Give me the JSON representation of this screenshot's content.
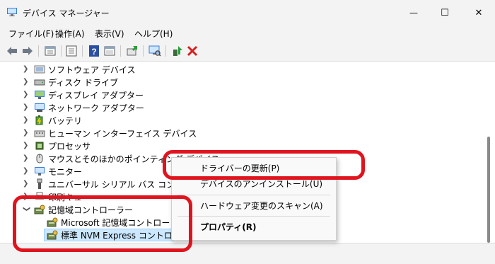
{
  "window": {
    "title": "デバイス マネージャー",
    "controls": {
      "minimize": "—",
      "maximize": "☐",
      "close": "✕"
    }
  },
  "menu": {
    "items": [
      "ファイル(F)",
      "操作(A)",
      "表示(V)",
      "ヘルプ(H)"
    ]
  },
  "toolbar": {
    "icons": [
      "back-arrow-icon",
      "forward-arrow-icon",
      "properties-sheet-icon",
      "console-tree-icon",
      "help-icon",
      "action-pane-icon",
      "update-driver-icon",
      "scan-hardware-icon",
      "enable-device-icon",
      "uninstall-x-icon"
    ]
  },
  "tree": {
    "items": [
      {
        "label": "ソフトウェア デバイス",
        "icon": "software-device-icon",
        "expanded": false
      },
      {
        "label": "ディスク ドライブ",
        "icon": "disk-drive-icon",
        "expanded": false
      },
      {
        "label": "ディスプレイ アダプター",
        "icon": "display-adapter-icon",
        "expanded": false
      },
      {
        "label": "ネットワーク アダプター",
        "icon": "network-adapter-icon",
        "expanded": false
      },
      {
        "label": "バッテリ",
        "icon": "battery-icon",
        "expanded": false
      },
      {
        "label": "ヒューマン インターフェイス デバイス",
        "icon": "hid-icon",
        "expanded": false
      },
      {
        "label": "プロセッサ",
        "icon": "processor-icon",
        "expanded": false
      },
      {
        "label": "マウスとそのほかのポインティング デバイス",
        "icon": "mouse-icon",
        "expanded": false
      },
      {
        "label": "モニター",
        "icon": "monitor-icon",
        "expanded": false
      },
      {
        "label": "ユニバーサル シリアル バス コントローラー",
        "icon": "usb-icon",
        "expanded": false
      },
      {
        "label": "印刷キュー",
        "icon": "print-queue-icon",
        "expanded": false
      },
      {
        "label": "記憶域コントローラー",
        "icon": "storage-controller-icon",
        "expanded": true
      },
      {
        "label": "Microsoft 記憶域コントローラー",
        "icon": "storage-controller-icon",
        "child": true
      },
      {
        "label": "標準 NVM Express コントローラー",
        "icon": "storage-controller-icon",
        "child": true,
        "selected": true
      }
    ]
  },
  "context_menu": {
    "items": [
      "ドライバーの更新(P)",
      "デバイスのアンインストール(U)",
      "ハードウェア変更のスキャン(A)",
      "プロパティ(R)"
    ]
  },
  "colors": {
    "highlight": "#e0141e",
    "selection": "#cce8ff"
  }
}
